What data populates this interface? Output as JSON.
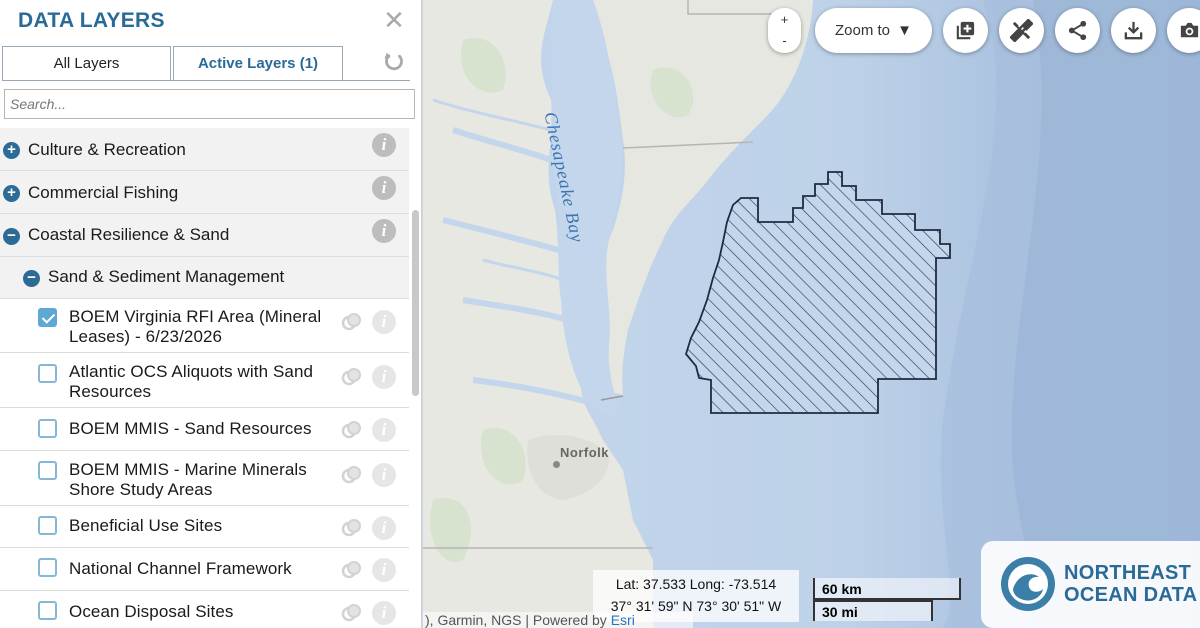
{
  "sidebar": {
    "title": "DATA LAYERS",
    "close_icon": "✕",
    "tabs": [
      {
        "label": "All Layers",
        "active": true
      },
      {
        "label": "Active Layers (1)",
        "active": false
      }
    ],
    "search_placeholder": "Search...",
    "categories": [
      {
        "label": "Culture & Recreation",
        "expanded": false
      },
      {
        "label": "Commercial Fishing",
        "expanded": false
      },
      {
        "label": "Coastal Resilience & Sand",
        "expanded": true
      }
    ],
    "subcategory": {
      "label": "Sand & Sediment Management",
      "expanded": true
    },
    "layers": [
      {
        "label": "BOEM Virginia RFI Area (Mineral Leases) - 6/23/2026",
        "checked": true
      },
      {
        "label": "Atlantic OCS Aliquots with Sand Resources",
        "checked": false
      },
      {
        "label": "BOEM MMIS - Sand Resources",
        "checked": false
      },
      {
        "label": "BOEM MMIS - Marine Minerals Shore Study Areas",
        "checked": false
      },
      {
        "label": "Beneficial Use Sites",
        "checked": false
      },
      {
        "label": "National Channel Framework",
        "checked": false
      },
      {
        "label": "Ocean Disposal Sites",
        "checked": false
      }
    ]
  },
  "map": {
    "zoom_in": "+",
    "zoom_out": "-",
    "zoom_to_label": "Zoom to",
    "toolbar_icons": [
      "add-layer-icon",
      "measure-icon",
      "share-icon",
      "download-icon",
      "camera-icon"
    ],
    "labels": {
      "bay": "Chesapeake Bay",
      "city": "Norfolk"
    },
    "coords": {
      "latlong": "Lat: 37.533 Long: -73.514",
      "dms": "37° 31' 59\" N 73° 30' 51\" W"
    },
    "scale": {
      "km": "60 km",
      "mi": "30 mi"
    },
    "attribution": {
      "text": "), Garmin, NGS | Powered by ",
      "esri": "Esri"
    },
    "brand": {
      "line1": "NORTHEAST",
      "line2": "OCEAN DATA"
    },
    "colors": {
      "land": "#e7e8e2",
      "water": "#c4d6ec",
      "deep_ocean": "#a9c1df",
      "polygon_hatch": "#2a3a55",
      "accent": "#2a6a97"
    }
  }
}
